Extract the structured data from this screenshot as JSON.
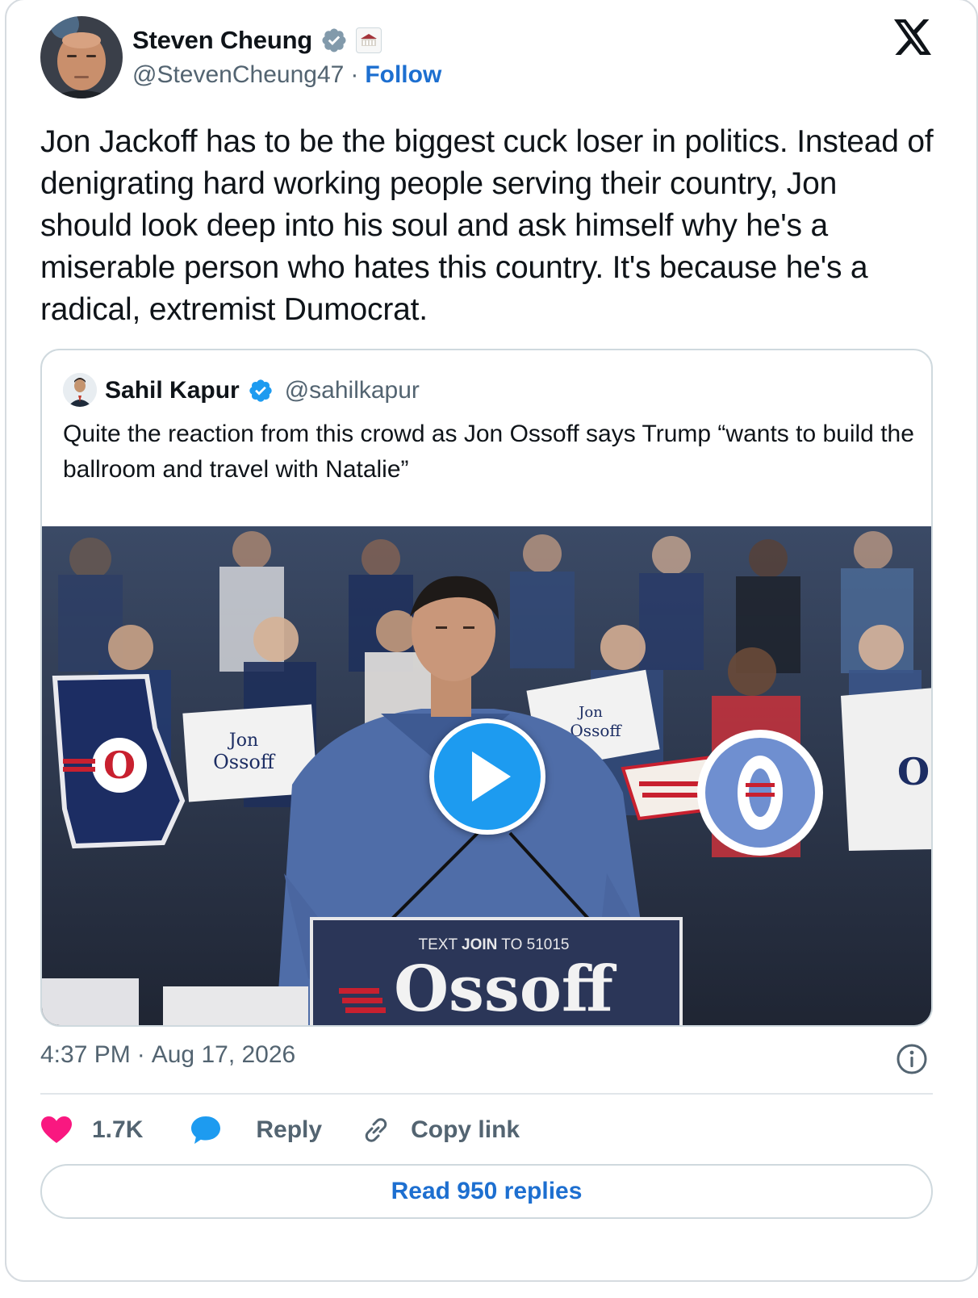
{
  "tweet": {
    "author": {
      "name": "Steven Cheung",
      "handle": "@StevenCheung47",
      "separator": "·",
      "follow_label": "Follow",
      "verified_color": "#829aab"
    },
    "text": "Jon Jackoff has to be the biggest cuck loser in politics. Instead of denigrating hard working people serving their country, Jon should look deep into his soul and ask himself why he's a miserable person who hates this country. It's because he's a radical, extremist Dumocrat.",
    "time": "4:37 PM",
    "date_separator": "·",
    "date": "Aug 17, 2026"
  },
  "quote": {
    "author": {
      "name": "Sahil Kapur",
      "handle": "@sahilkapur",
      "verified_color": "#1d9bf0"
    },
    "text": "Quite the reaction from this crowd as Jon Ossoff says Trump “wants to build the ballroom and travel with Natalie”",
    "media": {
      "type": "video",
      "podium_line1_a": "TEXT ",
      "podium_line1_b": "JOIN",
      "podium_line1_c": " TO 51015",
      "podium_logo": "Ossoff",
      "sign_text_1": "Jon",
      "sign_text_2": "Ossoff",
      "sign_letter": "O"
    }
  },
  "actions": {
    "likes_count": "1.7K",
    "reply_label": "Reply",
    "copy_link_label": "Copy link",
    "read_replies_label": "Read 950 replies",
    "like_color": "#f91880",
    "reply_color": "#1d9bf0"
  },
  "icons": {
    "close": "x-logo-icon",
    "info": "info-icon",
    "like": "heart-icon",
    "reply": "speech-bubble-icon",
    "copy": "link-icon",
    "play": "play-icon"
  }
}
